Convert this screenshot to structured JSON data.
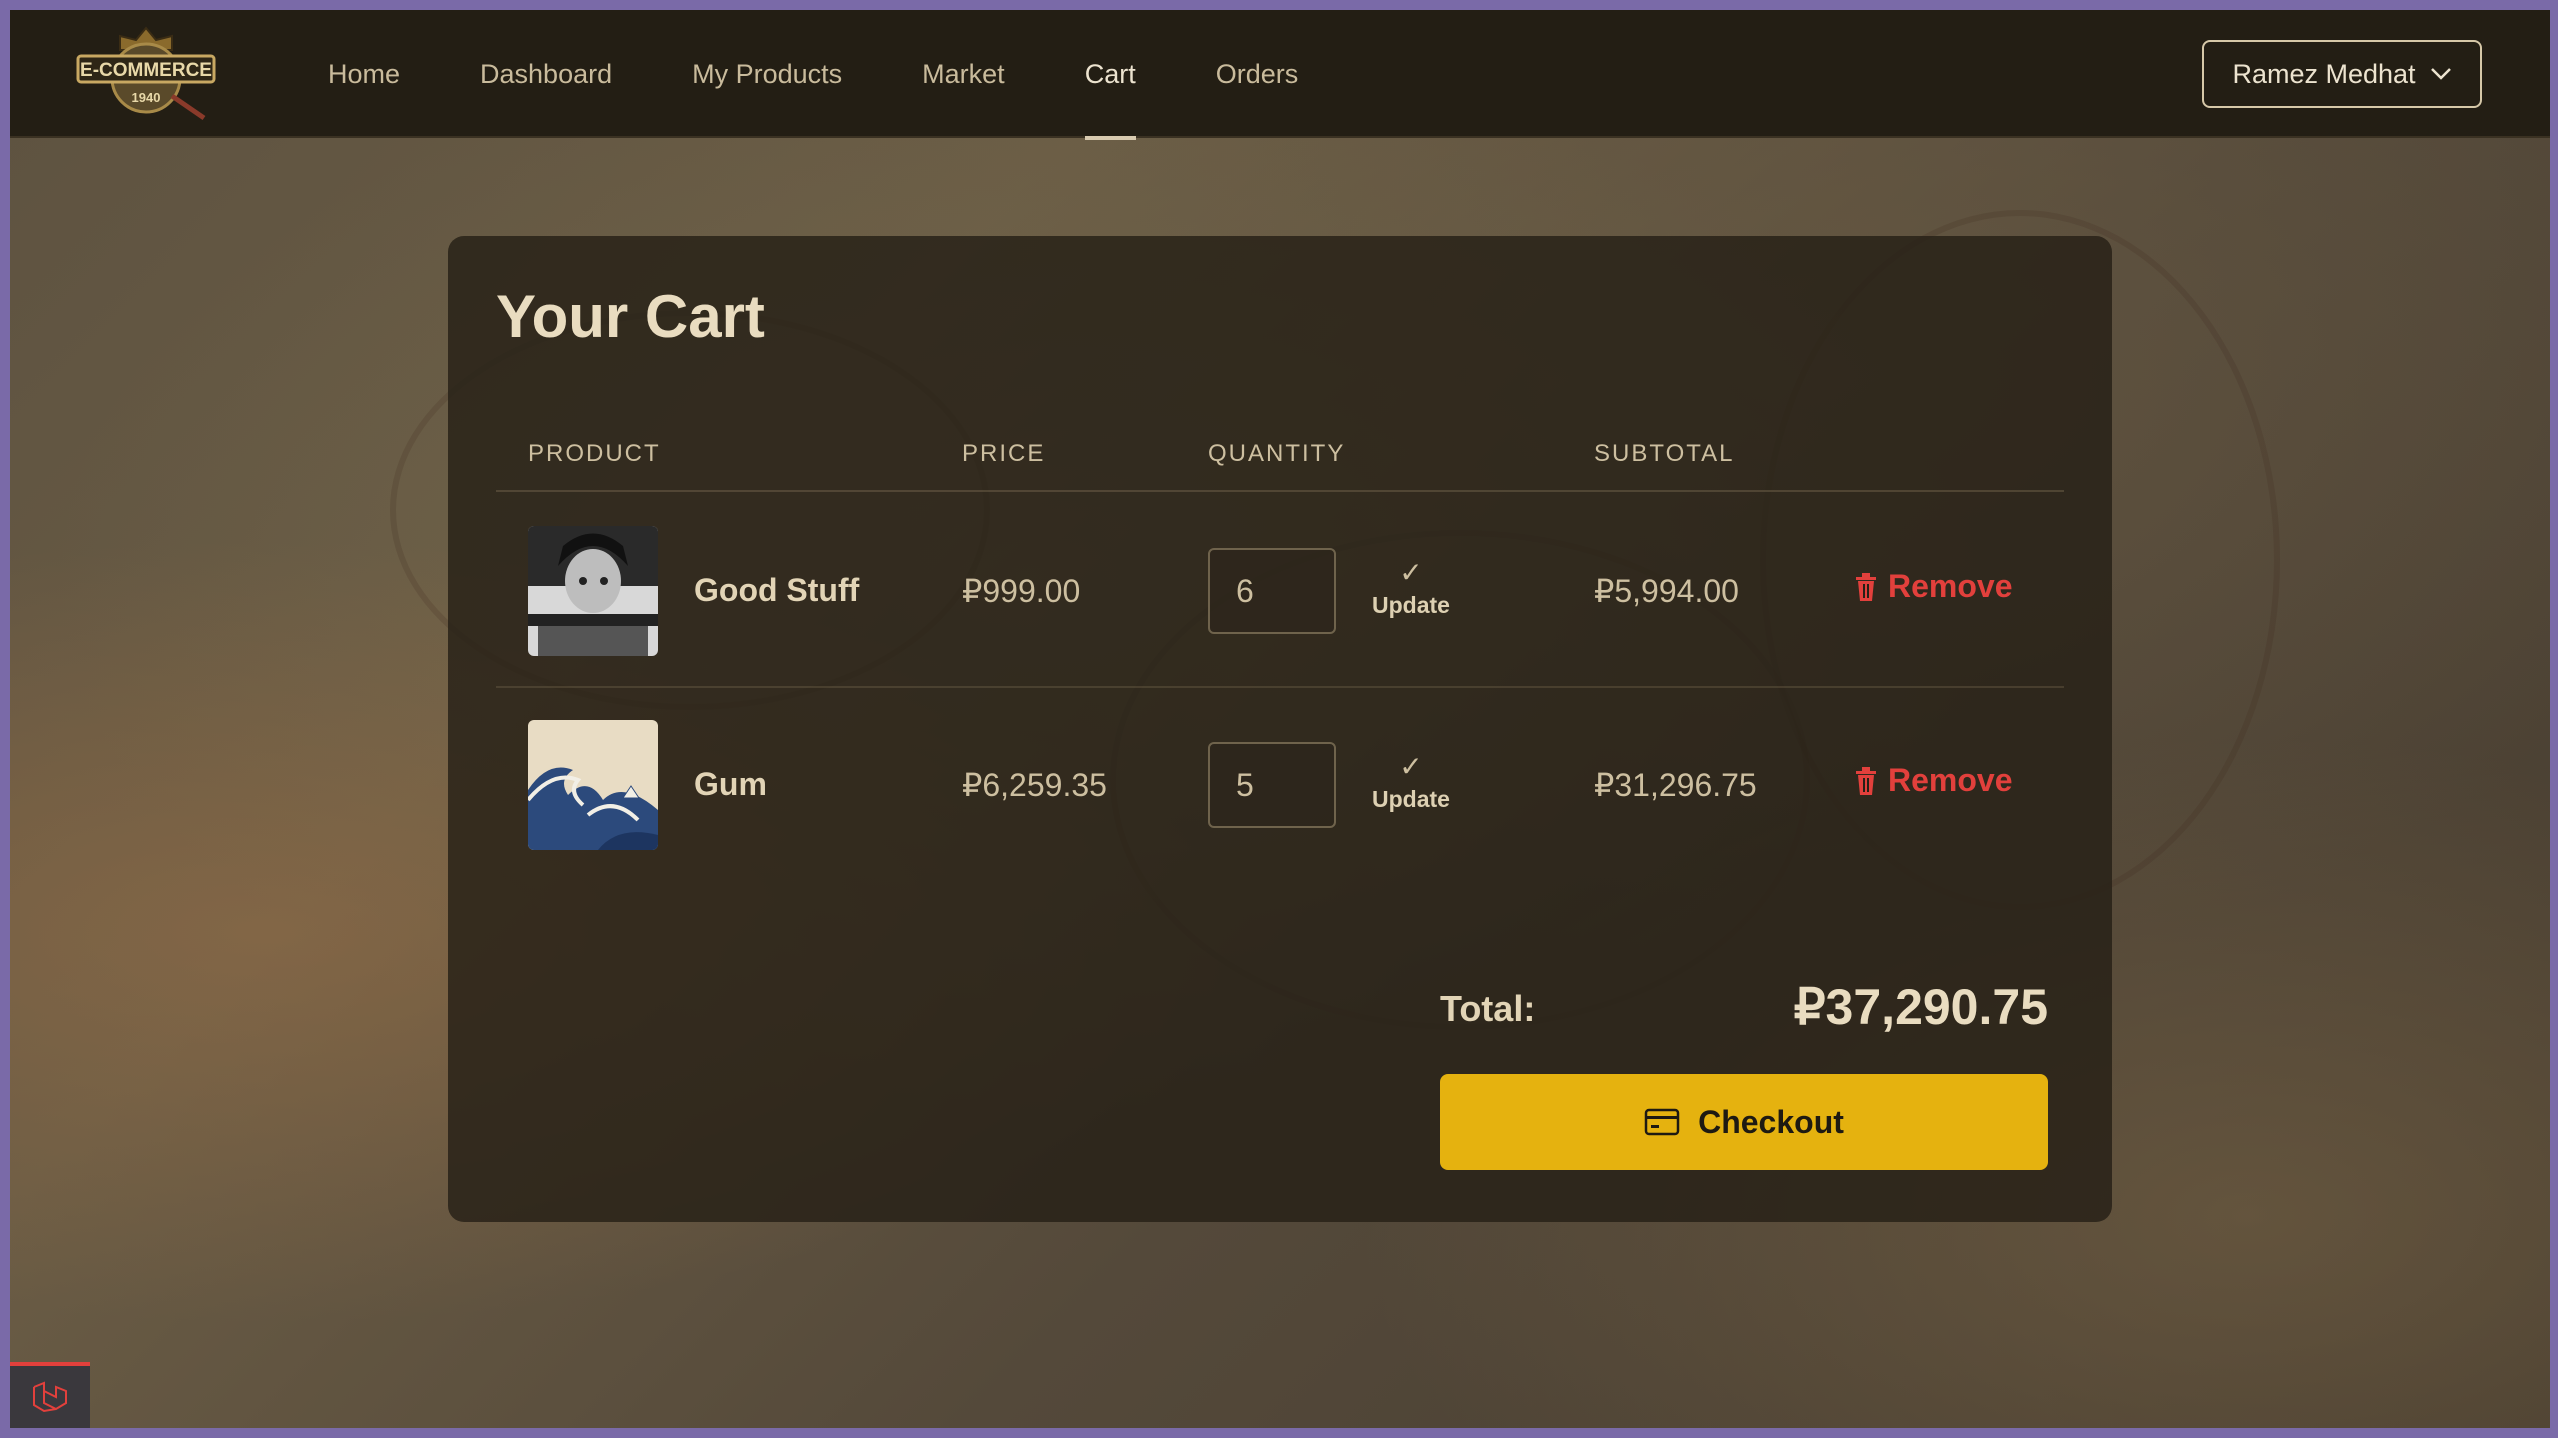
{
  "brand": {
    "logo_text": "E-COMMERCE",
    "logo_year": "1940"
  },
  "nav": {
    "items": [
      {
        "label": "Home",
        "active": false
      },
      {
        "label": "Dashboard",
        "active": false
      },
      {
        "label": "My Products",
        "active": false
      },
      {
        "label": "Market",
        "active": false
      },
      {
        "label": "Cart",
        "active": true
      },
      {
        "label": "Orders",
        "active": false
      }
    ],
    "user_name": "Ramez Medhat"
  },
  "cart": {
    "title": "Your Cart",
    "columns": {
      "product": "PRODUCT",
      "price": "PRICE",
      "quantity": "QUANTITY",
      "subtotal": "SUBTOTAL"
    },
    "items": [
      {
        "name": "Good Stuff",
        "price": "₽999.00",
        "quantity": "6",
        "update_label": "Update",
        "subtotal": "₽5,994.00",
        "remove_label": "Remove"
      },
      {
        "name": "Gum",
        "price": "₽6,259.35",
        "quantity": "5",
        "update_label": "Update",
        "subtotal": "₽31,296.75",
        "remove_label": "Remove"
      }
    ],
    "total_label": "Total:",
    "total_value": "₽37,290.75",
    "checkout_label": "Checkout"
  },
  "icons": {
    "user_menu": "chevron-down-icon",
    "update": "check-icon",
    "remove": "trash-icon",
    "checkout": "credit-card-icon",
    "dev_badge": "laravel-icon"
  },
  "colors": {
    "navbar_bg": "#231e14",
    "card_bg": "#262016",
    "checkout_bg": "#e5b20f",
    "remove": "#e2403c",
    "text": "#e2d4b6"
  }
}
